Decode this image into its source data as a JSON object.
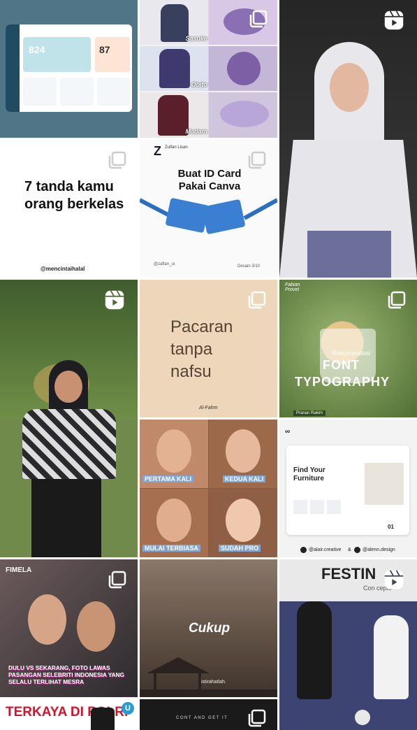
{
  "grid": {
    "posts": [
      {
        "id": "dashboard-ui",
        "numbers": [
          "824",
          "87"
        ]
      },
      {
        "id": "eye-anime",
        "labels": [
          "Sasuke",
          "Obito",
          "Madara"
        ]
      },
      {
        "id": "hijab-girl-reel",
        "type": "reel"
      },
      {
        "id": "tanda-berkelas",
        "headline": "7 tanda kamu orang berkelas",
        "handle": "@mencintaihalal"
      },
      {
        "id": "id-card-canva",
        "brand": "Zulfan Lisan",
        "headline": "Buat ID Card Pakai Canva",
        "footer_left": "@zaflan_ui",
        "footer_right": "Desain 3/10"
      },
      {
        "id": "graduate-reel",
        "type": "reel"
      },
      {
        "id": "pacaran",
        "headline": "Pacaran tanpa nafsu",
        "signature": "Al-Fahm"
      },
      {
        "id": "font-typography",
        "brand": "Fabian Provet",
        "line1": "Rekomendasi",
        "line2": "FONT",
        "line3": "TYPOGRAPHY",
        "tag": "Pranan Rakim"
      },
      {
        "id": "meme-faces",
        "captions": [
          "PERTAMA KALI",
          "KEDUA KALI",
          "MULAI TERBIASA",
          "SUDAH PRO"
        ]
      },
      {
        "id": "furniture-ui",
        "headline": "Find Your Furniture",
        "page": "01",
        "credits": [
          "@alair.creative",
          "&",
          "@alenn.design"
        ]
      },
      {
        "id": "fimela",
        "brand": "FIMELA",
        "caption": "DULU VS SEKARANG, FOTO LAWAS PASANGAN SELEBRITI INDONESIA YANG SELALU TERLIHAT MESRA"
      },
      {
        "id": "cukup",
        "title": "Cukup",
        "subtitle": "istirahatlah."
      },
      {
        "id": "futsal-reel",
        "type": "reel",
        "banner": "FESTIN",
        "banner2": "Con cepts"
      },
      {
        "id": "polri",
        "headline": "TERKAYA DI POLRI",
        "letter": "U"
      },
      {
        "id": "dark-post",
        "text": "CONT AND GET IT"
      }
    ]
  }
}
